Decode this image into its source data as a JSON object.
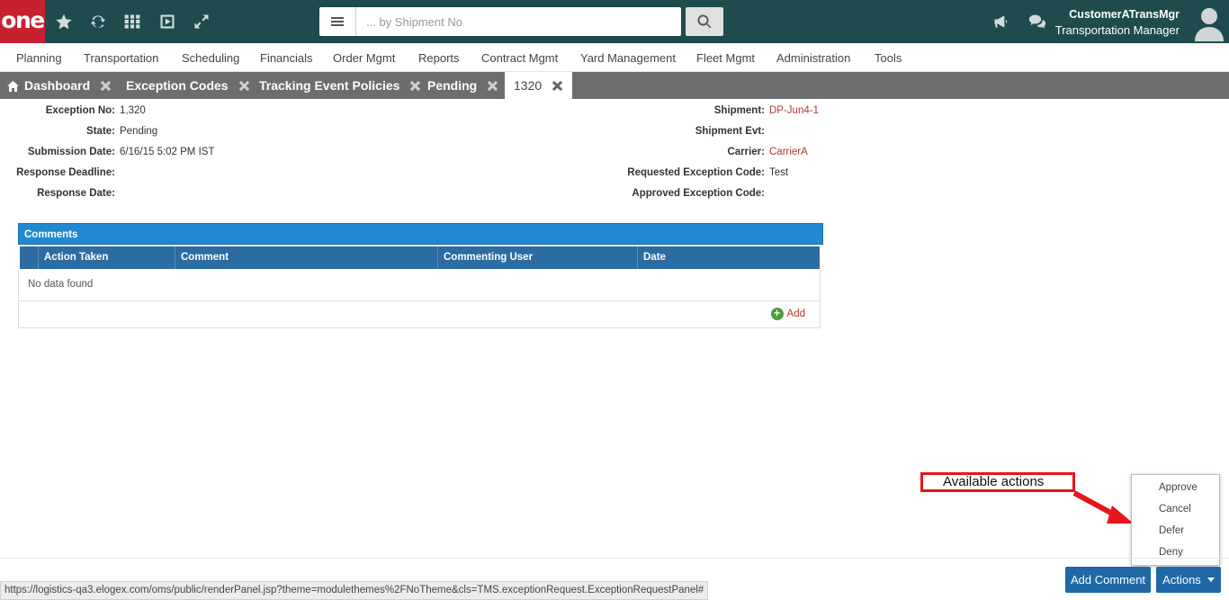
{
  "brand": {
    "logo_text": "one",
    "color": "#c8202f"
  },
  "topbar": {
    "icons": [
      "star-icon",
      "refresh-icon",
      "grid-icon",
      "play-icon",
      "expand-icon"
    ],
    "search": {
      "placeholder": "... by Shipment No",
      "value": ""
    },
    "user": {
      "name": "CustomerATransMgr",
      "role": "Transportation Manager"
    }
  },
  "menu": [
    "Planning",
    "Transportation",
    "Scheduling",
    "Financials",
    "Order Mgmt",
    "Reports",
    "Contract Mgmt",
    "Yard Management",
    "Fleet Mgmt",
    "Administration",
    "Tools"
  ],
  "tabs": [
    {
      "label": "Dashboard"
    },
    {
      "label": "Exception Codes"
    },
    {
      "label": "Tracking Event Policies"
    },
    {
      "label": "Pending"
    },
    {
      "label": "1320"
    }
  ],
  "details": {
    "left": [
      {
        "label": "Exception No:",
        "value": "1,320"
      },
      {
        "label": "State:",
        "value": "Pending"
      },
      {
        "label": "Submission Date:",
        "value": "6/16/15 5:02 PM IST"
      },
      {
        "label": "Response Deadline:",
        "value": ""
      },
      {
        "label": "Response Date:",
        "value": ""
      }
    ],
    "right": [
      {
        "label": "Shipment:",
        "value": "DP-Jun4-1"
      },
      {
        "label": "Shipment Evt:",
        "value": ""
      },
      {
        "label": "Carrier:",
        "value": "CarrierA"
      },
      {
        "label": "Requested Exception Code:",
        "value": "Test"
      },
      {
        "label": "Approved Exception Code:",
        "value": ""
      }
    ]
  },
  "comments": {
    "title": "Comments",
    "columns": [
      "Action Taken",
      "Comment",
      "Commenting User",
      "Date"
    ],
    "empty_text": "No data found",
    "add_label": "Add"
  },
  "footer": {
    "status_url": "https://logistics-qa3.elogex.com/oms/public/renderPanel.jsp?theme=modulethemes%2FNoTheme&cls=TMS.exceptionRequest.ExceptionRequestPanel#",
    "add_comment_label": "Add Comment",
    "actions_label": "Actions"
  },
  "actions_menu": [
    "Approve",
    "Cancel",
    "Defer",
    "Deny"
  ],
  "annotation": {
    "text": "Available actions",
    "color": "#e8151b"
  }
}
